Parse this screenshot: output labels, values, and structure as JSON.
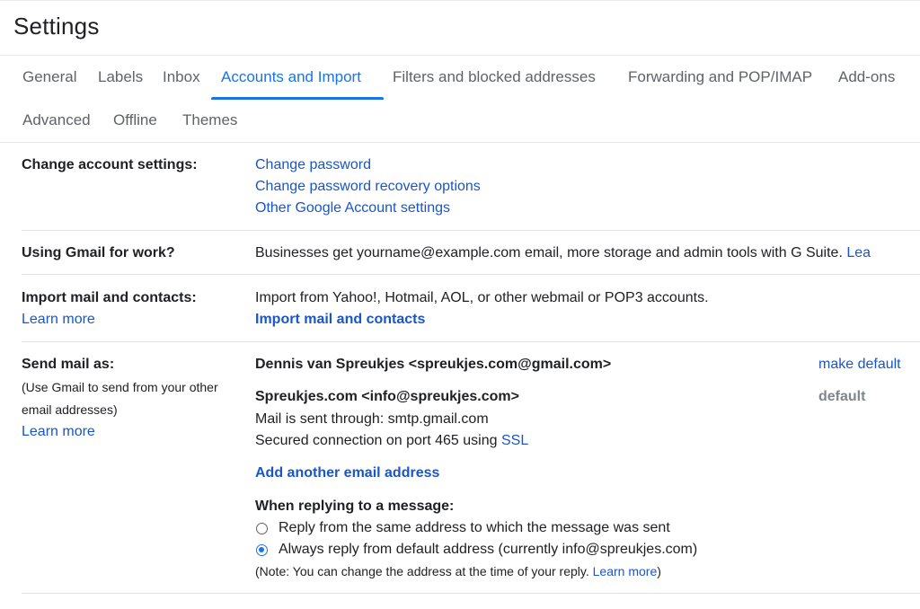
{
  "page": {
    "title": "Settings"
  },
  "tabs": [
    {
      "label": "General"
    },
    {
      "label": "Labels"
    },
    {
      "label": "Inbox"
    },
    {
      "label": "Accounts and Import",
      "active": true
    },
    {
      "label": "Filters and blocked addresses"
    },
    {
      "label": "Forwarding and POP/IMAP"
    },
    {
      "label": "Add-ons"
    },
    {
      "label": "Advanced"
    },
    {
      "label": "Offline"
    },
    {
      "label": "Themes"
    }
  ],
  "change_account": {
    "label": "Change account settings:",
    "links": [
      "Change password",
      "Change password recovery options",
      "Other Google Account settings"
    ]
  },
  "work": {
    "label": "Using Gmail for work?",
    "text": "Businesses get yourname@example.com email, more storage and admin tools with G Suite.",
    "link": "Lea"
  },
  "import": {
    "label": "Import mail and contacts:",
    "learn_more": "Learn more",
    "text": "Import from Yahoo!, Hotmail, AOL, or other webmail or POP3 accounts.",
    "action": "Import mail and contacts"
  },
  "send_as": {
    "label": "Send mail as:",
    "hint_line1": "(Use Gmail to send from your other",
    "hint_line2": "email addresses)",
    "learn_more": "Learn more",
    "accounts": [
      {
        "name": "Dennis van Spreukjes <spreukjes.com@gmail.com>",
        "action": "make default"
      },
      {
        "name": "Spreukjes.com <info@spreukjes.com>",
        "status": "default",
        "detail1": "Mail is sent through: smtp.gmail.com",
        "detail2_prefix": "Secured connection on port 465 using",
        "detail2_link": "SSL"
      }
    ],
    "add_address": "Add another email address",
    "reply_heading": "When replying to a message:",
    "reply_options": [
      {
        "label": "Reply from the same address to which the message was sent",
        "checked": false
      },
      {
        "label": "Always reply from default address (currently info@spreukjes.com)",
        "checked": true
      }
    ],
    "note_prefix": "(Note: You can change the address at the time of your reply.",
    "note_link": "Learn more",
    "note_suffix": ")"
  }
}
